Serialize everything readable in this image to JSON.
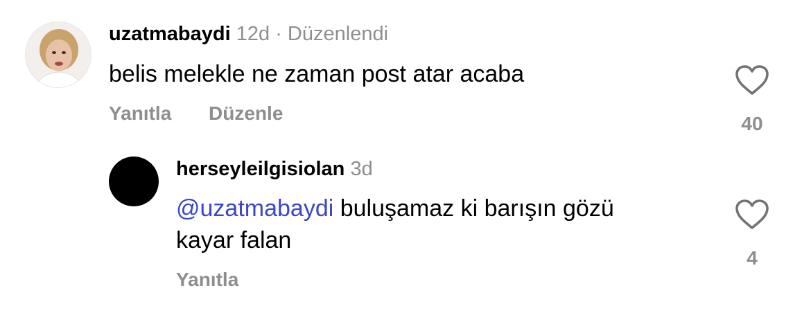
{
  "comment": {
    "username": "uzatmabaydi",
    "time": "12d",
    "separator": "·",
    "edited": "Düzenlendi",
    "text": "belis melekle ne zaman post atar acaba",
    "reply_label": "Yanıtla",
    "edit_label": "Düzenle",
    "like_count": "40"
  },
  "reply": {
    "username": "herseyleilgisiolan",
    "time": "3d",
    "mention": "@uzatmabaydi",
    "text_line1": " buluşamaz ki barışın gözü",
    "text_line2": "kayar falan",
    "reply_label": "Yanıtla",
    "like_count": "4"
  },
  "colors": {
    "mention": "#3b46c8",
    "secondary_text": "#8e8e8e",
    "heart_outline": "#737373"
  },
  "icons": [
    "heart-icon"
  ]
}
